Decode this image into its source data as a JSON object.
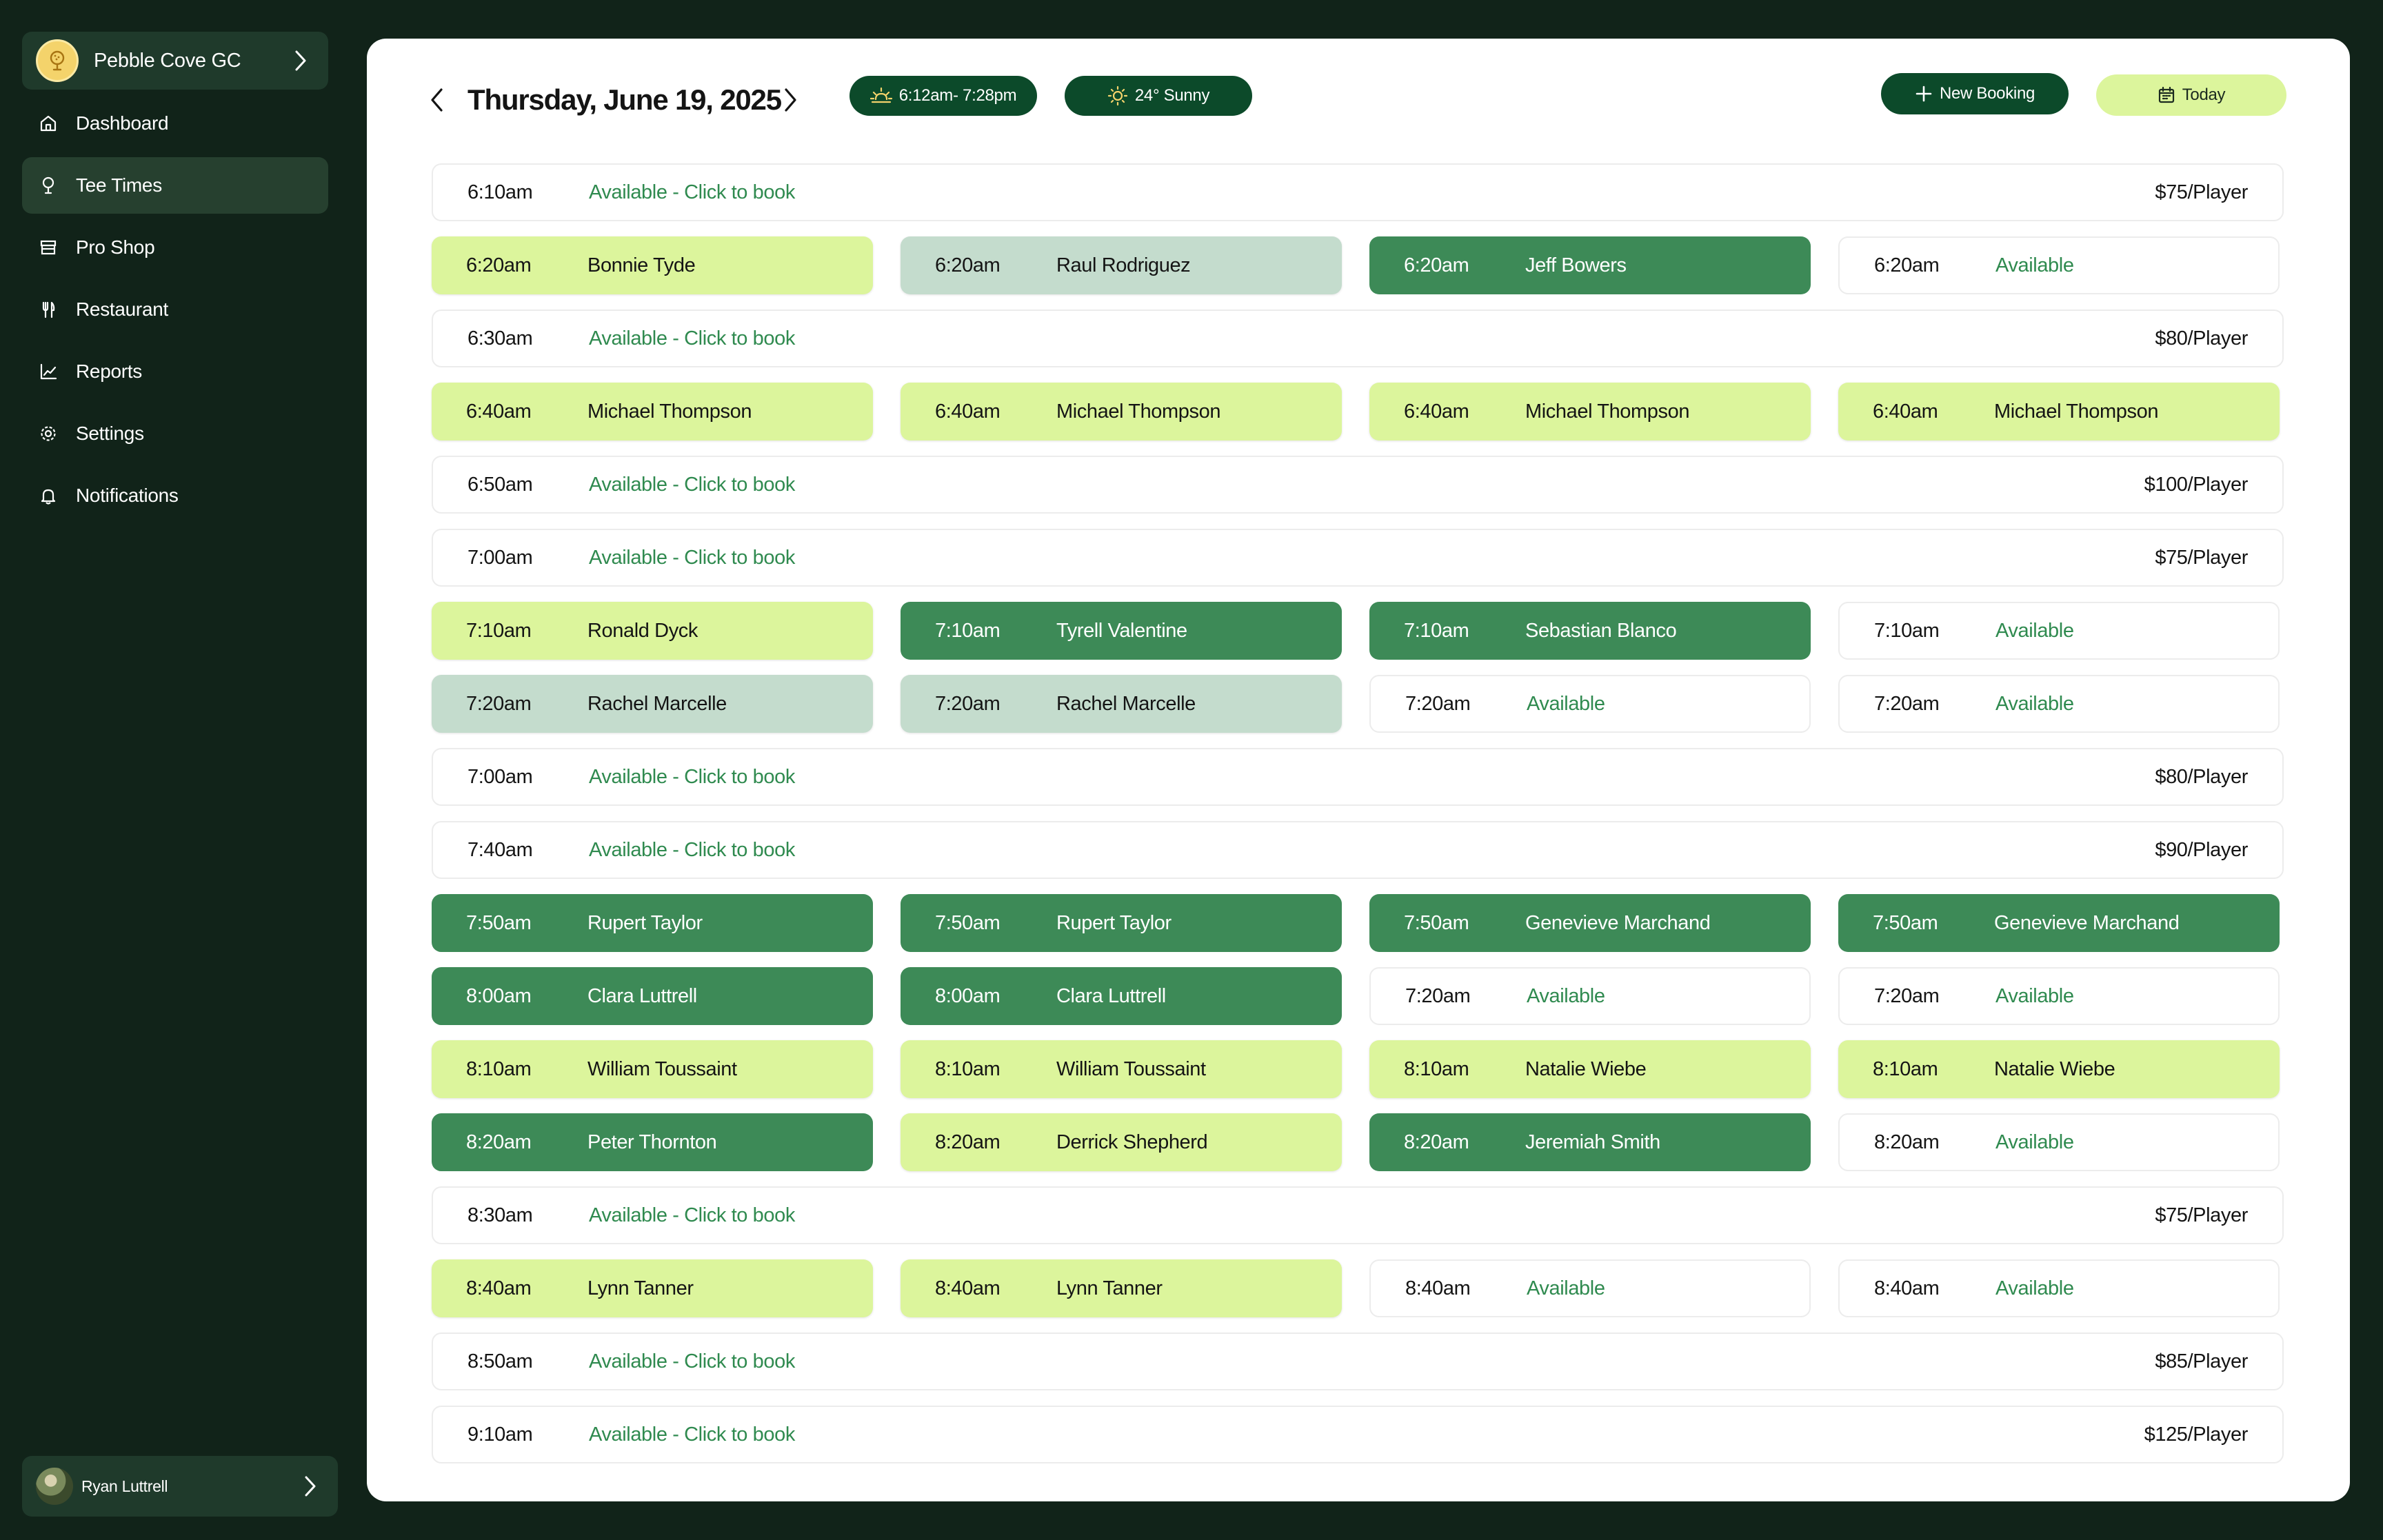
{
  "sidebar": {
    "club_name": "Pebble Cove GC",
    "items": [
      {
        "label": "Dashboard",
        "icon": "home-icon",
        "active": false
      },
      {
        "label": "Tee Times",
        "icon": "golf-pin-icon",
        "active": true
      },
      {
        "label": "Pro Shop",
        "icon": "store-icon",
        "active": false
      },
      {
        "label": "Restaurant",
        "icon": "utensils-icon",
        "active": false
      },
      {
        "label": "Reports",
        "icon": "chart-icon",
        "active": false
      },
      {
        "label": "Settings",
        "icon": "gear-icon",
        "active": false
      },
      {
        "label": "Notifications",
        "icon": "bell-icon",
        "active": false
      }
    ],
    "user_name": "Ryan Luttrell"
  },
  "header": {
    "date": "Thursday, June 19, 2025",
    "sun_times": "6:12am- 7:28pm",
    "weather": "24° Sunny",
    "new_booking_label": "New Booking",
    "today_label": "Today"
  },
  "colors": {
    "sidebar_bg": "#112319",
    "accent_dark": "#0c4a2a",
    "booked_green": "#3d8a57",
    "booked_lime": "#dcf59c",
    "booked_grey": "#c4dccd",
    "available_text": "#2f8a4f"
  },
  "rows": [
    {
      "type": "open",
      "time": "6:10am",
      "status": "Available - Click to book",
      "price": "$75/Player"
    },
    {
      "type": "slots",
      "slots": [
        {
          "time": "6:20am",
          "name": "Bonnie Tyde",
          "style": "lime"
        },
        {
          "time": "6:20am",
          "name": "Raul Rodriguez",
          "style": "grey"
        },
        {
          "time": "6:20am",
          "name": "Jeff Bowers",
          "style": "green"
        },
        {
          "time": "6:20am",
          "name": "Available",
          "style": "avail"
        }
      ]
    },
    {
      "type": "open",
      "time": "6:30am",
      "status": "Available - Click to book",
      "price": "$80/Player"
    },
    {
      "type": "slots",
      "slots": [
        {
          "time": "6:40am",
          "name": "Michael Thompson",
          "style": "lime"
        },
        {
          "time": "6:40am",
          "name": "Michael Thompson",
          "style": "lime"
        },
        {
          "time": "6:40am",
          "name": "Michael Thompson",
          "style": "lime"
        },
        {
          "time": "6:40am",
          "name": "Michael Thompson",
          "style": "lime"
        }
      ]
    },
    {
      "type": "open",
      "time": "6:50am",
      "status": "Available - Click to book",
      "price": "$100/Player"
    },
    {
      "type": "open",
      "time": "7:00am",
      "status": "Available - Click to book",
      "price": "$75/Player"
    },
    {
      "type": "slots",
      "slots": [
        {
          "time": "7:10am",
          "name": "Ronald Dyck",
          "style": "lime"
        },
        {
          "time": "7:10am",
          "name": "Tyrell Valentine",
          "style": "green"
        },
        {
          "time": "7:10am",
          "name": "Sebastian Blanco",
          "style": "green"
        },
        {
          "time": "7:10am",
          "name": "Available",
          "style": "avail"
        }
      ]
    },
    {
      "type": "slots",
      "slots": [
        {
          "time": "7:20am",
          "name": "Rachel Marcelle",
          "style": "grey"
        },
        {
          "time": "7:20am",
          "name": "Rachel Marcelle",
          "style": "grey"
        },
        {
          "time": "7:20am",
          "name": "Available",
          "style": "avail"
        },
        {
          "time": "7:20am",
          "name": "Available",
          "style": "avail"
        }
      ]
    },
    {
      "type": "open",
      "time": "7:00am",
      "status": "Available - Click to book",
      "price": "$80/Player"
    },
    {
      "type": "open",
      "time": "7:40am",
      "status": "Available - Click to book",
      "price": "$90/Player"
    },
    {
      "type": "slots",
      "slots": [
        {
          "time": "7:50am",
          "name": "Rupert Taylor",
          "style": "green"
        },
        {
          "time": "7:50am",
          "name": "Rupert Taylor",
          "style": "green"
        },
        {
          "time": "7:50am",
          "name": "Genevieve Marchand",
          "style": "green"
        },
        {
          "time": "7:50am",
          "name": "Genevieve Marchand",
          "style": "green"
        }
      ]
    },
    {
      "type": "slots",
      "slots": [
        {
          "time": "8:00am",
          "name": "Clara Luttrell",
          "style": "green"
        },
        {
          "time": "8:00am",
          "name": "Clara Luttrell",
          "style": "green"
        },
        {
          "time": "7:20am",
          "name": "Available",
          "style": "avail"
        },
        {
          "time": "7:20am",
          "name": "Available",
          "style": "avail"
        }
      ]
    },
    {
      "type": "slots",
      "slots": [
        {
          "time": "8:10am",
          "name": "William Toussaint",
          "style": "lime"
        },
        {
          "time": "8:10am",
          "name": "William Toussaint",
          "style": "lime"
        },
        {
          "time": "8:10am",
          "name": "Natalie Wiebe",
          "style": "lime"
        },
        {
          "time": "8:10am",
          "name": "Natalie Wiebe",
          "style": "lime"
        }
      ]
    },
    {
      "type": "slots",
      "slots": [
        {
          "time": "8:20am",
          "name": "Peter Thornton",
          "style": "green"
        },
        {
          "time": "8:20am",
          "name": "Derrick Shepherd",
          "style": "lime"
        },
        {
          "time": "8:20am",
          "name": "Jeremiah Smith",
          "style": "green"
        },
        {
          "time": "8:20am",
          "name": "Available",
          "style": "avail"
        }
      ]
    },
    {
      "type": "open",
      "time": "8:30am",
      "status": "Available - Click to book",
      "price": "$75/Player"
    },
    {
      "type": "slots",
      "slots": [
        {
          "time": "8:40am",
          "name": "Lynn Tanner",
          "style": "lime"
        },
        {
          "time": "8:40am",
          "name": "Lynn Tanner",
          "style": "lime"
        },
        {
          "time": "8:40am",
          "name": "Available",
          "style": "avail"
        },
        {
          "time": "8:40am",
          "name": "Available",
          "style": "avail"
        }
      ]
    },
    {
      "type": "open",
      "time": "8:50am",
      "status": "Available - Click to book",
      "price": "$85/Player"
    },
    {
      "type": "open",
      "time": "9:10am",
      "status": "Available - Click to book",
      "price": "$125/Player"
    }
  ]
}
